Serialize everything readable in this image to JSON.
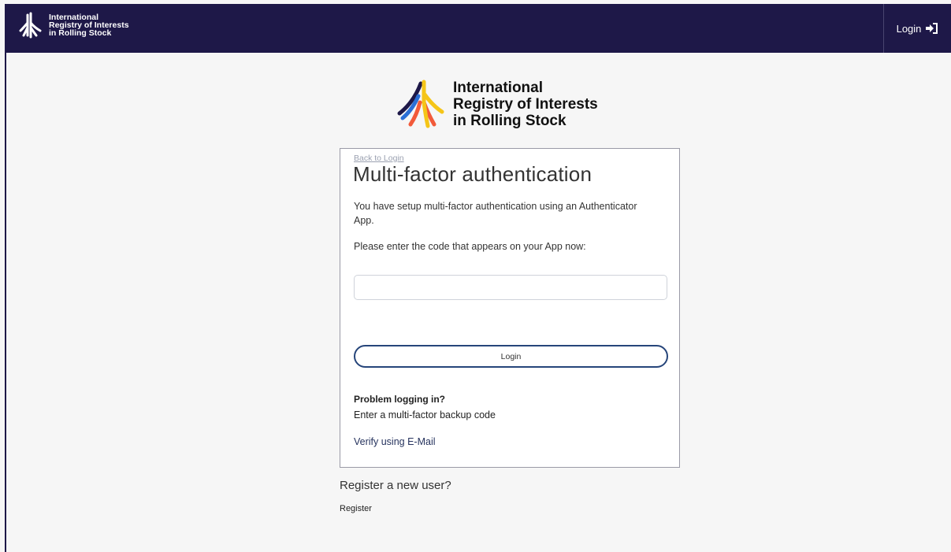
{
  "header": {
    "brand_lines": [
      "International",
      "Registry of Interests",
      "in Rolling Stock"
    ],
    "login_label": "Login"
  },
  "logo": {
    "lines": [
      "International",
      "Registry of Interests",
      "in Rolling Stock"
    ],
    "colors": [
      "#1e1848",
      "#2b6fd6",
      "#f25a3a",
      "#f5c518"
    ]
  },
  "card": {
    "back_link": "Back to Login",
    "title": "Multi-factor authentication",
    "text1": "You have setup multi-factor authentication using an Authenticator App.",
    "text2": "Please enter the code that appears on your App now:",
    "code_value": "",
    "code_placeholder": "",
    "login_button": "Login",
    "problem_title": "Problem logging in?",
    "backup_link": "Enter a multi-factor backup code",
    "email_link": "Verify using E-Mail"
  },
  "register": {
    "question": "Register a new user?",
    "link": "Register"
  },
  "colors": {
    "navbar": "#1e1848",
    "background": "#f6f6f6",
    "button_border": "#26457a"
  }
}
